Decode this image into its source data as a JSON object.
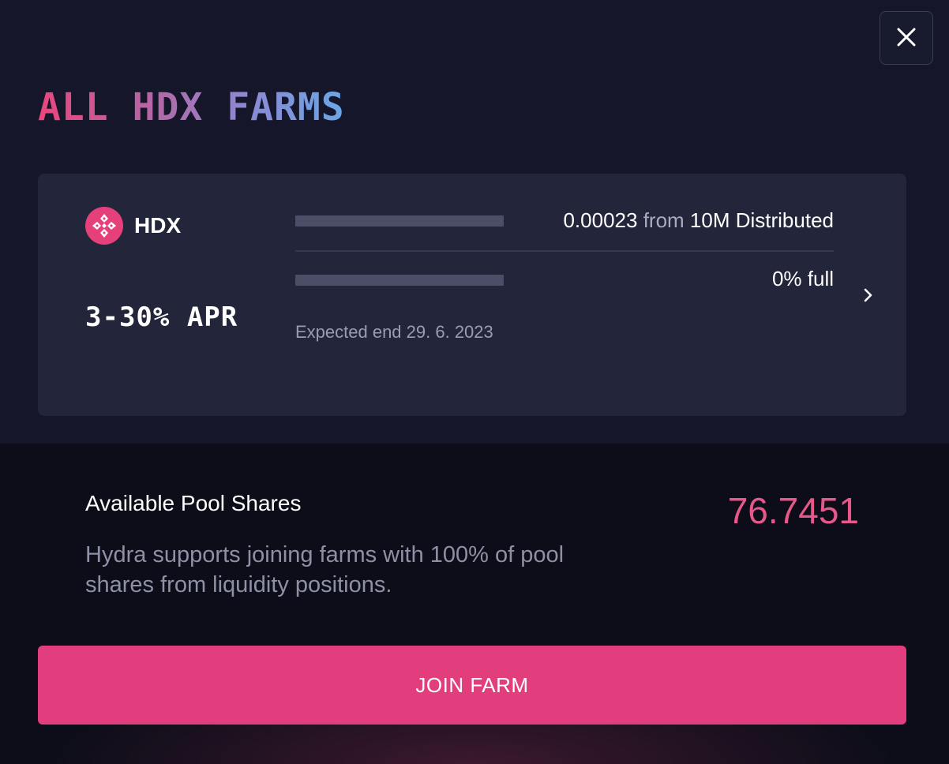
{
  "modal": {
    "title": "ALL HDX FARMS"
  },
  "farm": {
    "asset_symbol": "HDX",
    "apr": "3-30% APR",
    "distributed_amount": "0.00023",
    "distributed_from": "from",
    "distributed_total": "10M Distributed",
    "distributed_progress": 0,
    "full_label": "0% full",
    "full_progress": 0,
    "expected_end": "Expected end 29. 6. 2023"
  },
  "shares": {
    "title": "Available Pool Shares",
    "value": "76.7451",
    "description": "Hydra supports joining farms with 100% of pool shares from liquidity positions."
  },
  "actions": {
    "join_label": "JOIN FARM"
  },
  "colors": {
    "accent": "#e23d7d",
    "card_bg": "#23253a",
    "modal_bg": "#15162a",
    "bottom_bg": "#0c0d18",
    "value": "#e8578a"
  },
  "icons": {
    "close": "close-icon",
    "asset": "hdx-logo-icon",
    "chevron": "chevron-right-icon"
  }
}
